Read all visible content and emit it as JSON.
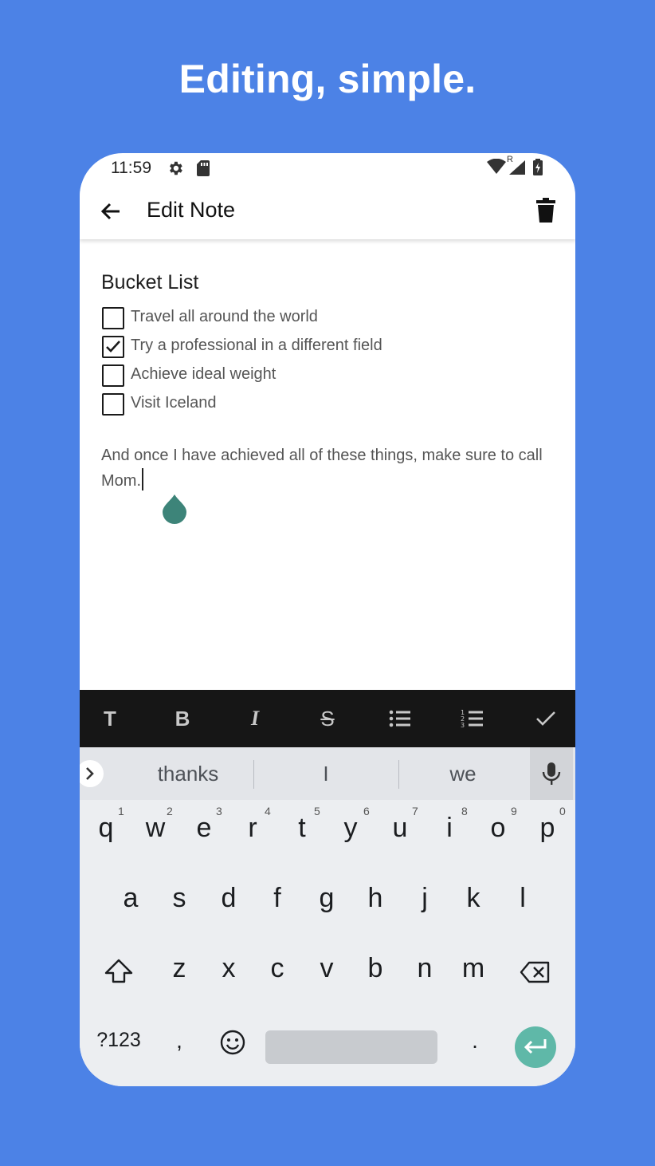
{
  "headline": "Editing, simple.",
  "status_bar": {
    "time": "11:59",
    "left_icons": [
      "gear-icon",
      "sd-card-icon"
    ],
    "right_icons": [
      "wifi-icon",
      "signal-icon",
      "battery-icon"
    ],
    "roaming_label": "R"
  },
  "app_bar": {
    "title": "Edit Note",
    "back_icon": "arrow-left-icon",
    "delete_icon": "trash-icon"
  },
  "note": {
    "title": "Bucket List",
    "checklist": [
      {
        "label": "Travel all around the world",
        "checked": false
      },
      {
        "label": "Try a professional in a different field",
        "checked": true
      },
      {
        "label": "Achieve ideal weight",
        "checked": false
      },
      {
        "label": "Visit Iceland",
        "checked": false
      }
    ],
    "body": "And once I have achieved all of these things, make sure to call Mom."
  },
  "format_toolbar": {
    "items": [
      {
        "name": "text-size",
        "label": "T"
      },
      {
        "name": "bold",
        "label": "B"
      },
      {
        "name": "italic",
        "label": "I"
      },
      {
        "name": "strikethrough",
        "label": "S"
      },
      {
        "name": "bullet-list",
        "label": ""
      },
      {
        "name": "numbered-list",
        "label": ""
      },
      {
        "name": "done",
        "label": ""
      }
    ]
  },
  "keyboard": {
    "suggestions": [
      "thanks",
      "I",
      "we"
    ],
    "row1": [
      "q",
      "w",
      "e",
      "r",
      "t",
      "y",
      "u",
      "i",
      "o",
      "p"
    ],
    "row1_hints": [
      "1",
      "2",
      "3",
      "4",
      "5",
      "6",
      "7",
      "8",
      "9",
      "0"
    ],
    "row2": [
      "a",
      "s",
      "d",
      "f",
      "g",
      "h",
      "j",
      "k",
      "l"
    ],
    "row3": [
      "z",
      "x",
      "c",
      "v",
      "b",
      "n",
      "m"
    ],
    "symbols_label": "?123",
    "comma_label": ",",
    "period_label": "."
  },
  "colors": {
    "background": "#4c82e6",
    "toolbar": "#161616",
    "keyboard": "#eceef1",
    "accent": "#5fb8a8",
    "cursor_handle": "#3d8479"
  }
}
